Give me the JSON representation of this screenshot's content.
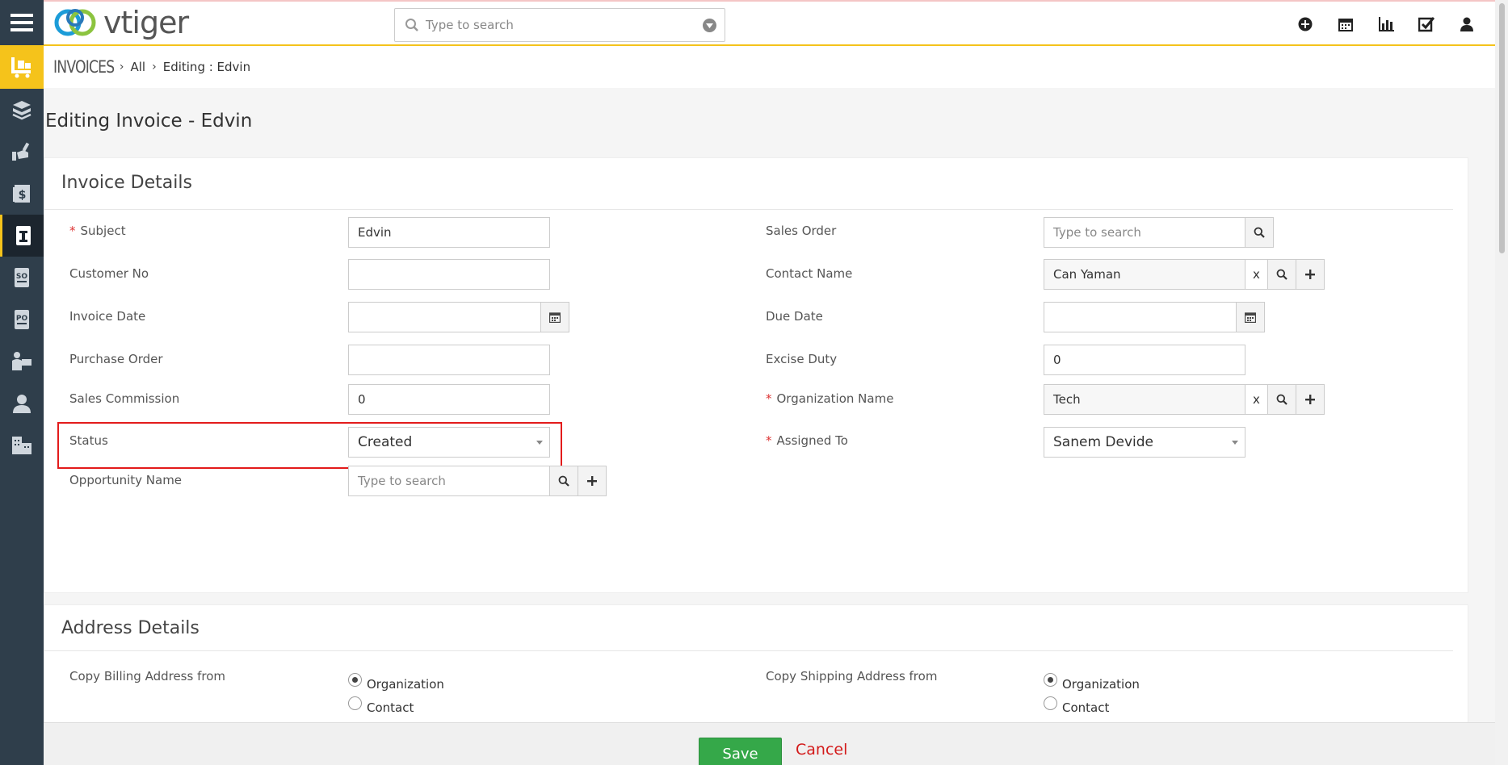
{
  "app": {
    "logo_text": "vtiger"
  },
  "search": {
    "placeholder": "Type to search"
  },
  "breadcrumb": {
    "module": "INVOICES",
    "items": [
      "All",
      "Editing : Edvin"
    ]
  },
  "page": {
    "title": "Editing Invoice - Edvin"
  },
  "invoice_details": {
    "title": "Invoice Details",
    "subject": {
      "label": "Subject",
      "value": "Edvin"
    },
    "customer_no": {
      "label": "Customer No",
      "value": ""
    },
    "invoice_date": {
      "label": "Invoice Date",
      "value": ""
    },
    "purchase_order": {
      "label": "Purchase Order",
      "value": ""
    },
    "sales_commission": {
      "label": "Sales Commission",
      "value": "0"
    },
    "status": {
      "label": "Status",
      "value": "Created"
    },
    "opportunity_name": {
      "label": "Opportunity Name",
      "placeholder": "Type to search"
    },
    "sales_order": {
      "label": "Sales Order",
      "placeholder": "Type to search"
    },
    "contact_name": {
      "label": "Contact Name",
      "value": "Can Yaman",
      "clear": "x"
    },
    "due_date": {
      "label": "Due Date",
      "value": ""
    },
    "excise_duty": {
      "label": "Excise Duty",
      "value": "0"
    },
    "organization_name": {
      "label": "Organization Name",
      "value": "Tech",
      "clear": "x"
    },
    "assigned_to": {
      "label": "Assigned To",
      "value": "Sanem Devide"
    },
    "required_mark": "*"
  },
  "address_details": {
    "title": "Address Details",
    "billing": {
      "label": "Copy Billing Address from",
      "options": [
        "Organization",
        "Contact"
      ],
      "selected": "Organization"
    },
    "shipping": {
      "label": "Copy Shipping Address from",
      "options": [
        "Organization",
        "Contact"
      ],
      "selected": "Organization"
    }
  },
  "footer": {
    "save_label": "Save",
    "cancel_label": "Cancel"
  },
  "colors": {
    "accent": "#f5c31b",
    "sidebar": "#2f3e4b",
    "save": "#35a849",
    "cancel": "#d31b1b",
    "highlight": "#e31b1b"
  }
}
